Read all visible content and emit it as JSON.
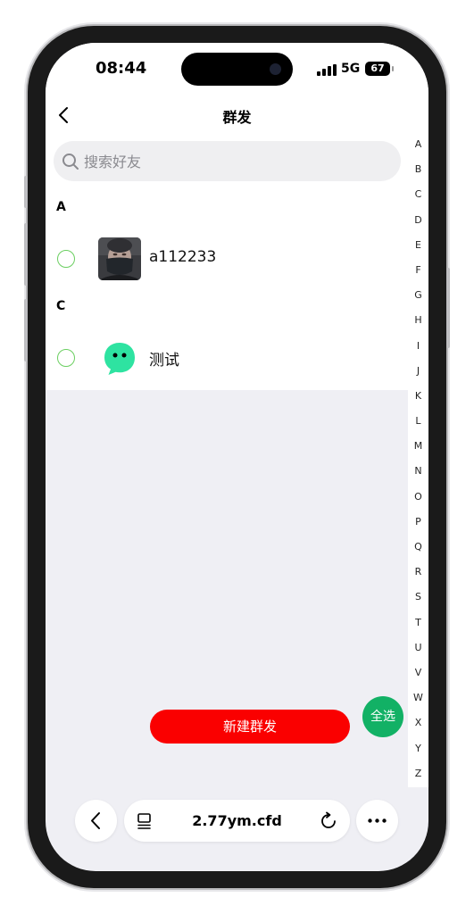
{
  "status_bar": {
    "time": "08:44",
    "network": "5G",
    "battery": "67"
  },
  "nav": {
    "title": "群发"
  },
  "search": {
    "placeholder": "搜索好友",
    "value": ""
  },
  "sections": [
    {
      "letter": "A",
      "contacts": [
        {
          "name": "a112233",
          "avatar": "person-photo-avatar"
        }
      ]
    },
    {
      "letter": "C",
      "contacts": [
        {
          "name": "测试",
          "avatar": "chat-bubble-avatar"
        }
      ]
    }
  ],
  "index_letters": [
    "A",
    "B",
    "C",
    "D",
    "E",
    "F",
    "G",
    "H",
    "I",
    "J",
    "K",
    "L",
    "M",
    "N",
    "O",
    "P",
    "Q",
    "R",
    "S",
    "T",
    "U",
    "V",
    "W",
    "X",
    "Y",
    "Z"
  ],
  "actions": {
    "create_group_send": "新建群发",
    "select_all": "全选"
  },
  "browser": {
    "url": "2.77ym.cfd"
  },
  "colors": {
    "accent_red": "#fa0000",
    "accent_green": "#12b165",
    "radio_border": "#6bcf61",
    "avatar_green": "#2ee3a1"
  }
}
